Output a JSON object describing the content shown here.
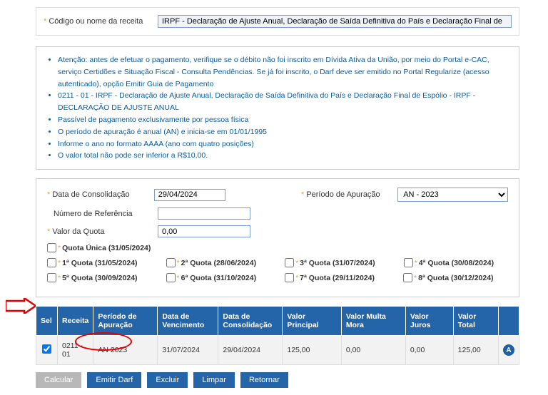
{
  "header": {
    "field_label_prefix": "Código ou nome da receita",
    "recipe_value": "IRPF - Declaração de Ajuste Anual, Declaração de Saída Definitiva do País e Declaração Final de"
  },
  "info": {
    "items": [
      "Atenção: antes de efetuar o pagamento, verifique se o débito não foi inscrito em Dívida Ativa da União, por meio do Portal e-CAC, serviço Certidões e Situação Fiscal - Consulta Pendências. Se já foi inscrito, o Darf deve ser emitido no Portal Regularize (acesso autenticado), opção Emitir Guia de Pagamento",
      "0211 - 01 - IRPF - Declaração de Ajuste Anual, Declaração de Saída Definitiva do País e Declaração Final de Espólio - IRPF - DECLARAÇÃO DE AJUSTE ANUAL",
      "Passível de pagamento exclusivamente por pessoa física",
      "O período de apuração é anual (AN) e inicia-se em 01/01/1995",
      "Informe o ano no formato AAAA (ano com quatro posições)",
      "O valor total não pode ser inferior a R$10,00."
    ]
  },
  "form": {
    "data_consolidacao_label": "Data de Consolidação",
    "data_consolidacao_value": "29/04/2024",
    "periodo_apuracao_label": "Período de Apuração",
    "periodo_apuracao_value": "AN - 2023",
    "numero_referencia_label": "Número de Referência",
    "numero_referencia_value": "",
    "valor_quota_label": "Valor da Quota",
    "valor_quota_value": "0,00"
  },
  "quotas": {
    "unica": "Quota Única (31/05/2024)",
    "q1": "1ª Quota (31/05/2024)",
    "q2": "2ª Quota (28/06/2024)",
    "q3": "3ª Quota (31/07/2024)",
    "q4": "4ª Quota (30/08/2024)",
    "q5": "5ª Quota (30/09/2024)",
    "q6": "6ª Quota (31/10/2024)",
    "q7": "7ª Quota (29/11/2024)",
    "q8": "8ª Quota (30/12/2024)"
  },
  "table": {
    "headers": {
      "sel": "Sel",
      "receita": "Receita",
      "periodo": "Período de Apuração",
      "vencimento": "Data de Vencimento",
      "consolidacao": "Data de Consolidação",
      "principal": "Valor Principal",
      "multa": "Valor Multa Mora",
      "juros": "Valor Juros",
      "total": "Valor Total"
    },
    "row": {
      "receita": "0211 - 01",
      "periodo": "AN 2023",
      "vencimento": "31/07/2024",
      "consolidacao": "29/04/2024",
      "principal": "125,00",
      "multa": "0,00",
      "juros": "0,00",
      "total": "125,00"
    }
  },
  "buttons": {
    "calcular": "Calcular",
    "emitir": "Emitir Darf",
    "excluir": "Excluir",
    "limpar": "Limpar",
    "retornar": "Retornar"
  }
}
